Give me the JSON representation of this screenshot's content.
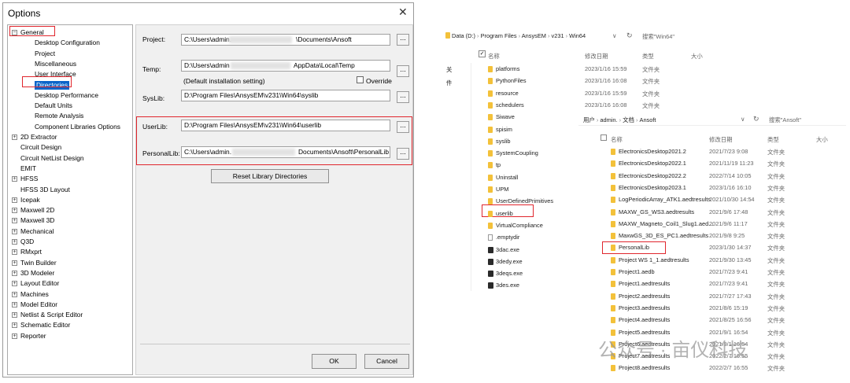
{
  "dialog": {
    "title": "Options",
    "close": "✕",
    "tree": [
      {
        "label": "General",
        "expander": "−"
      },
      {
        "label": "Desktop Configuration"
      },
      {
        "label": "Project"
      },
      {
        "label": "Miscellaneous"
      },
      {
        "label": "User Interface"
      },
      {
        "label": "Directories"
      },
      {
        "label": "Desktop Performance"
      },
      {
        "label": "Default Units"
      },
      {
        "label": "Remote Analysis"
      },
      {
        "label": "Component Libraries Options"
      },
      {
        "label": "2D Extractor",
        "expander": "+"
      },
      {
        "label": "Circuit Design"
      },
      {
        "label": "Circuit NetList Design"
      },
      {
        "label": "EMIT"
      },
      {
        "label": "HFSS",
        "expander": "+"
      },
      {
        "label": "HFSS 3D Layout"
      },
      {
        "label": "Icepak",
        "expander": "+"
      },
      {
        "label": "Maxwell 2D",
        "expander": "+"
      },
      {
        "label": "Maxwell 3D",
        "expander": "+"
      },
      {
        "label": "Mechanical",
        "expander": "+"
      },
      {
        "label": "Q3D",
        "expander": "+"
      },
      {
        "label": "RMxprt",
        "expander": "+"
      },
      {
        "label": "Twin Builder",
        "expander": "+"
      },
      {
        "label": "3D Modeler",
        "expander": "+"
      },
      {
        "label": "Layout Editor",
        "expander": "+"
      },
      {
        "label": "Machines",
        "expander": "+"
      },
      {
        "label": "Model Editor",
        "expander": "+"
      },
      {
        "label": "Netlist & Script Editor",
        "expander": "+"
      },
      {
        "label": "Schematic Editor",
        "expander": "+"
      },
      {
        "label": "Reporter",
        "expander": "+"
      }
    ],
    "project_label": "Project:",
    "project_a": "C:\\Users\\admin.",
    "project_b": "\\Documents\\Ansoft",
    "temp_label": "Temp:",
    "temp_a": "D:\\Users\\admin",
    "temp_b": "AppData\\Local\\Temp",
    "temp_note": "(Default installation setting)",
    "override_label": "Override",
    "syslib_label": "SysLib:",
    "syslib_value": "D:\\Program Files\\AnsysEM\\v231\\Win64\\syslib",
    "userlib_label": "UserLib:",
    "userlib_value": "D:\\Program Files\\AnsysEM\\v231\\Win64\\userlib",
    "personallib_label": "PersonalLib:",
    "personallib_a": "C:\\Users\\admin.",
    "personallib_b": "Documents\\Ansoft\\PersonalLib",
    "browse": "...",
    "reset_button": "Reset Library Directories",
    "ok_button": "OK",
    "cancel_button": "Cancel"
  },
  "explorer1": {
    "breadcrumb": [
      "Data (D:)",
      "Program Files",
      "AnsysEM",
      "v231",
      "Win64"
    ],
    "search": "搜索\"Win64\"",
    "headers": {
      "name": "名称",
      "date": "修改日期",
      "type": "类型",
      "size": "大小"
    },
    "side_labels": [
      "关",
      "件"
    ],
    "rows": [
      {
        "name": "platforms",
        "date": "2023/1/16 15:59",
        "type": "文件夹",
        "icon": "folder"
      },
      {
        "name": "PythonFiles",
        "date": "2023/1/16 16:08",
        "type": "文件夹",
        "icon": "folder"
      },
      {
        "name": "resource",
        "date": "2023/1/16 15:59",
        "type": "文件夹",
        "icon": "folder"
      },
      {
        "name": "schedulers",
        "date": "2023/1/16 16:08",
        "type": "文件夹",
        "icon": "folder"
      },
      {
        "name": "Siwave",
        "date": "",
        "type": "",
        "icon": "folder"
      },
      {
        "name": "spisim",
        "date": "",
        "type": "",
        "icon": "folder"
      },
      {
        "name": "syslib",
        "date": "",
        "type": "",
        "icon": "folder"
      },
      {
        "name": "SystemCoupling",
        "date": "",
        "type": "",
        "icon": "folder"
      },
      {
        "name": "tp",
        "date": "",
        "type": "",
        "icon": "folder"
      },
      {
        "name": "Uninstall",
        "date": "",
        "type": "",
        "icon": "folder"
      },
      {
        "name": "UPM",
        "date": "",
        "type": "",
        "icon": "folder"
      },
      {
        "name": "UserDefinedPrimitives",
        "date": "",
        "type": "",
        "icon": "folder"
      },
      {
        "name": "userlib",
        "date": "",
        "type": "",
        "icon": "folder"
      },
      {
        "name": "VirtualCompliance",
        "date": "",
        "type": "",
        "icon": "folder"
      },
      {
        "name": ".emptydir",
        "date": "",
        "type": "",
        "icon": "file"
      },
      {
        "name": "3dac.exe",
        "date": "",
        "type": "",
        "icon": "exe"
      },
      {
        "name": "3dedy.exe",
        "date": "",
        "type": "",
        "icon": "exe"
      },
      {
        "name": "3deqs.exe",
        "date": "",
        "type": "",
        "icon": "exe"
      },
      {
        "name": "3des.exe",
        "date": "",
        "type": "",
        "icon": "exe"
      }
    ]
  },
  "explorer2": {
    "breadcrumb": [
      "用户",
      "admin.",
      "文档",
      "Ansoft"
    ],
    "search": "搜索\"Ansoft\"",
    "headers": {
      "name": "名称",
      "date": "修改日期",
      "type": "类型",
      "size": "大小"
    },
    "rows": [
      {
        "name": "ElectronicsDesktop2021.2",
        "date": "2021/7/23 9:08",
        "type": "文件夹"
      },
      {
        "name": "ElectronicsDesktop2022.1",
        "date": "2021/11/19 11:23",
        "type": "文件夹"
      },
      {
        "name": "ElectronicsDesktop2022.2",
        "date": "2022/7/14 10:05",
        "type": "文件夹"
      },
      {
        "name": "ElectronicsDesktop2023.1",
        "date": "2023/1/16 16:10",
        "type": "文件夹"
      },
      {
        "name": "LogPeriodicArray_ATK1.aedtresults",
        "date": "2021/10/30 14:54",
        "type": "文件夹"
      },
      {
        "name": "MAXW_GS_WS3.aedtresults",
        "date": "2021/9/6 17:48",
        "type": "文件夹"
      },
      {
        "name": "MAXW_Magneto_Coil1_Slug1.aed...",
        "date": "2021/9/6 11:17",
        "type": "文件夹"
      },
      {
        "name": "MaxwGS_3D_ES_PC1.aedtresults",
        "date": "2021/9/8 9:25",
        "type": "文件夹"
      },
      {
        "name": "PersonalLib",
        "date": "2023/1/30 14:37",
        "type": "文件夹"
      },
      {
        "name": "Project WS 1_1.aedtresults",
        "date": "2021/9/30 13:45",
        "type": "文件夹"
      },
      {
        "name": "Project1.aedb",
        "date": "2021/7/23 9:41",
        "type": "文件夹"
      },
      {
        "name": "Project1.aedtresults",
        "date": "2021/7/23 9:41",
        "type": "文件夹"
      },
      {
        "name": "Project2.aedtresults",
        "date": "2021/7/27 17:43",
        "type": "文件夹"
      },
      {
        "name": "Project3.aedtresults",
        "date": "2021/8/6 15:19",
        "type": "文件夹"
      },
      {
        "name": "Project4.aedtresults",
        "date": "2021/8/25 16:56",
        "type": "文件夹"
      },
      {
        "name": "Project5.aedtresults",
        "date": "2021/9/1 16:54",
        "type": "文件夹"
      },
      {
        "name": "Project6.aedtresults",
        "date": "2021/9/1 16:54",
        "type": "文件夹"
      },
      {
        "name": "Project7.aedtresults",
        "date": "2022/2/7 16:55",
        "type": "文件夹"
      },
      {
        "name": "Project8.aedtresults",
        "date": "2022/2/7 16:55",
        "type": "文件夹"
      }
    ]
  },
  "watermark": "公众号 · 亩仪科技"
}
